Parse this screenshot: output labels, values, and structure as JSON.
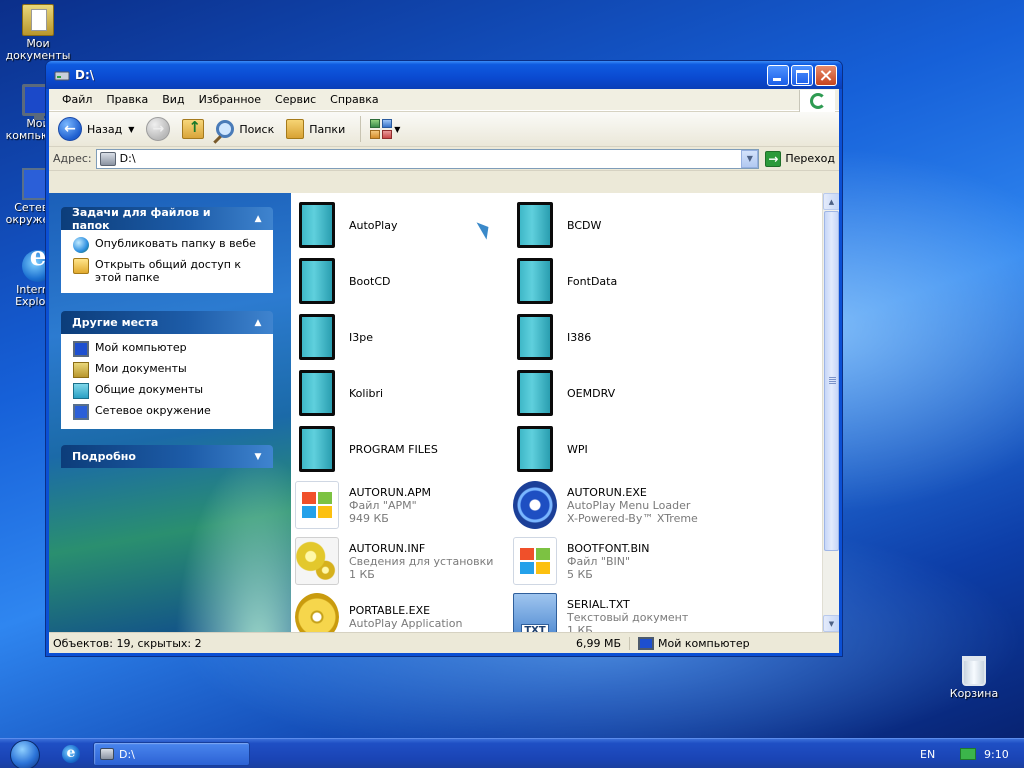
{
  "desktop": {
    "icons": [
      {
        "label": "Мои документы"
      },
      {
        "label": "Мой компьютер"
      },
      {
        "label": "Сетевое окружение"
      },
      {
        "label": "Internet Explorer"
      },
      {
        "label": "Корзина"
      }
    ]
  },
  "window": {
    "title": "D:\\",
    "menu": [
      "Файл",
      "Правка",
      "Вид",
      "Избранное",
      "Сервис",
      "Справка"
    ],
    "toolbar": {
      "back_label": "Назад",
      "search_label": "Поиск",
      "folders_label": "Папки"
    },
    "address": {
      "label": "Адрес:",
      "value": "D:\\",
      "go_label": "Переход"
    },
    "taskpane": {
      "file_tasks": {
        "title": "Задачи для файлов и папок",
        "items": [
          "Опубликовать папку в вебе",
          "Открыть общий доступ к этой папке"
        ]
      },
      "other_places": {
        "title": "Другие места",
        "items": [
          "Мой компьютер",
          "Мои документы",
          "Общие документы",
          "Сетевое окружение"
        ]
      },
      "details": {
        "title": "Подробно"
      }
    },
    "files": [
      {
        "name": "AutoPlay",
        "line2": "",
        "line3": "",
        "icon": "folder-icon"
      },
      {
        "name": "BCDW",
        "line2": "",
        "line3": "",
        "icon": "folder-icon"
      },
      {
        "name": "BootCD",
        "line2": "",
        "line3": "",
        "icon": "folder-icon"
      },
      {
        "name": "FontData",
        "line2": "",
        "line3": "",
        "icon": "folder-icon"
      },
      {
        "name": "I3pe",
        "line2": "",
        "line3": "",
        "icon": "folder-icon"
      },
      {
        "name": "I386",
        "line2": "",
        "line3": "",
        "icon": "folder-icon"
      },
      {
        "name": "Kolibri",
        "line2": "",
        "line3": "",
        "icon": "folder-icon"
      },
      {
        "name": "OEMDRV",
        "line2": "",
        "line3": "",
        "icon": "folder-icon"
      },
      {
        "name": "PROGRAM FILES",
        "line2": "",
        "line3": "",
        "icon": "folder-icon"
      },
      {
        "name": "WPI",
        "line2": "",
        "line3": "",
        "icon": "folder-icon"
      },
      {
        "name": "AUTORUN.APM",
        "line2": "Файл \"APM\"",
        "line3": "949 КБ",
        "icon": "windows-file-icon"
      },
      {
        "name": "AUTORUN.EXE",
        "line2": "AutoPlay Menu Loader",
        "line3": "X-Powered-By™ XTreme",
        "icon": "autoplay-disc-icon"
      },
      {
        "name": "AUTORUN.INF",
        "line2": "Сведения для установки",
        "line3": "1 КБ",
        "icon": "setup-info-icon"
      },
      {
        "name": "BOOTFONT.BIN",
        "line2": "Файл \"BIN\"",
        "line3": "5 КБ",
        "icon": "windows-file-icon"
      },
      {
        "name": "PORTABLE.EXE",
        "line2": "AutoPlay Application",
        "line3": "",
        "icon": "cd-icon"
      },
      {
        "name": "SERIAL.TXT",
        "line2": "Текстовый документ",
        "line3": "1 КБ",
        "icon": "text-file-icon"
      }
    ],
    "txt_badge": "TXT",
    "status": {
      "objects": "Объектов: 19, скрытых: 2",
      "size": "6,99 МБ",
      "location": "Мой компьютер"
    }
  },
  "taskbar": {
    "window_button": "D:\\",
    "lang": "EN",
    "clock": "9:10"
  }
}
